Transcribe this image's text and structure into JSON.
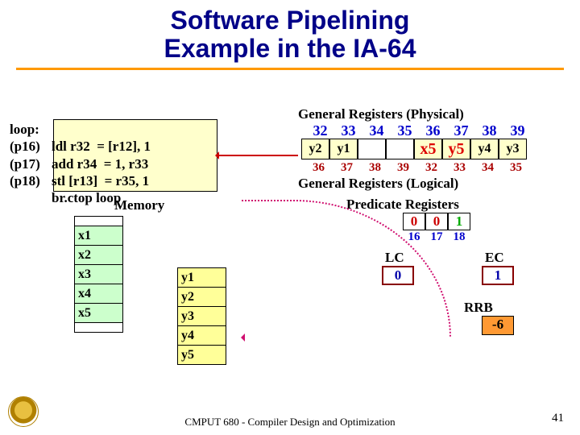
{
  "title_line1": "Software Pipelining",
  "title_line2": "Example in the IA-64",
  "code": {
    "loop_label": "loop:",
    "rows": [
      {
        "pred": "(p16)",
        "op": "ldl  r32",
        "rhs": "= [r12], 1"
      },
      {
        "pred": "(p17)",
        "op": "add r34",
        "rhs": "= 1, r33"
      },
      {
        "pred": "(p18)",
        "op": "stl [r13]",
        "rhs": "= r35, 1"
      },
      {
        "pred": "",
        "op": "br.ctop loop",
        "rhs": ""
      }
    ]
  },
  "memory_label": "Memory",
  "memory_x": [
    "x1",
    "x2",
    "x3",
    "x4",
    "x5"
  ],
  "memory_y": [
    "y1",
    "y2",
    "y3",
    "y4",
    "y5"
  ],
  "gpr": {
    "phys_label": "General Registers (Physical)",
    "phys_idx": [
      "32",
      "33",
      "34",
      "35",
      "36",
      "37",
      "38",
      "39"
    ],
    "values": [
      "y2",
      "y1",
      "",
      "",
      "x5",
      "y5",
      "y4",
      "y3"
    ],
    "log_idx": [
      "36",
      "37",
      "38",
      "39",
      "32",
      "33",
      "34",
      "35"
    ],
    "log_label": "General Registers (Logical)",
    "hilite_cols": [
      4,
      5
    ]
  },
  "predicate": {
    "label": "Predicate Registers",
    "values": [
      "0",
      "0",
      "1"
    ],
    "states": [
      "off",
      "off",
      "on"
    ],
    "idx": [
      "16",
      "17",
      "18"
    ]
  },
  "lc": {
    "label": "LC",
    "value": "0"
  },
  "ec": {
    "label": "EC",
    "value": "1"
  },
  "rrb": {
    "label": "RRB",
    "value": "-6"
  },
  "footer": "CMPUT 680 - Compiler Design and Optimization",
  "page": "41"
}
